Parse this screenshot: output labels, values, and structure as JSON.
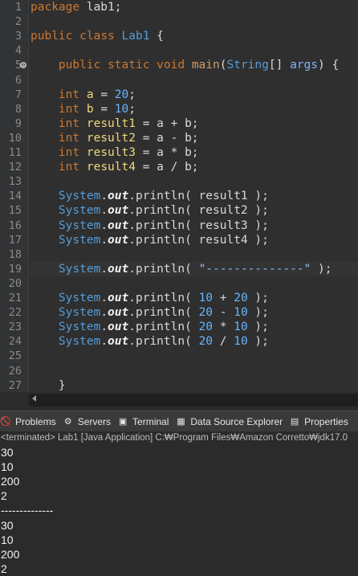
{
  "editor": {
    "line_numbers": [
      "1",
      "2",
      "3",
      "4",
      "5",
      "6",
      "7",
      "8",
      "9",
      "10",
      "11",
      "12",
      "13",
      "14",
      "15",
      "16",
      "17",
      "18",
      "19",
      "20",
      "21",
      "22",
      "23",
      "24",
      "25",
      "26",
      "27"
    ],
    "fold_marker": "⊖",
    "lines": [
      {
        "ln": "1",
        "parts": [
          [
            "kw",
            "package"
          ],
          [
            "pl",
            " lab1;"
          ]
        ]
      },
      {
        "ln": "2",
        "parts": []
      },
      {
        "ln": "3",
        "parts": [
          [
            "kw",
            "public"
          ],
          [
            "pl",
            " "
          ],
          [
            "kw",
            "class"
          ],
          [
            "pl",
            " "
          ],
          [
            "cls",
            "Lab1"
          ],
          [
            "pl",
            " {"
          ]
        ]
      },
      {
        "ln": "4",
        "parts": []
      },
      {
        "ln": "5",
        "parts": [
          [
            "pl",
            "    "
          ],
          [
            "kw",
            "public"
          ],
          [
            "pl",
            " "
          ],
          [
            "kw",
            "static"
          ],
          [
            "pl",
            " "
          ],
          [
            "kw",
            "void"
          ],
          [
            "pl",
            " "
          ],
          [
            "fn",
            "main"
          ],
          [
            "pl",
            "("
          ],
          [
            "cls",
            "String"
          ],
          [
            "pl",
            "[] "
          ],
          [
            "args",
            "args"
          ],
          [
            "pl",
            ") {"
          ]
        ]
      },
      {
        "ln": "6",
        "parts": []
      },
      {
        "ln": "7",
        "parts": [
          [
            "pl",
            "    "
          ],
          [
            "kw",
            "int"
          ],
          [
            "pl",
            " "
          ],
          [
            "var",
            "a"
          ],
          [
            "pl",
            " = "
          ],
          [
            "num",
            "20"
          ],
          [
            "pl",
            ";"
          ]
        ]
      },
      {
        "ln": "8",
        "parts": [
          [
            "pl",
            "    "
          ],
          [
            "kw",
            "int"
          ],
          [
            "pl",
            " "
          ],
          [
            "var",
            "b"
          ],
          [
            "pl",
            " = "
          ],
          [
            "num",
            "10"
          ],
          [
            "pl",
            ";"
          ]
        ]
      },
      {
        "ln": "9",
        "parts": [
          [
            "pl",
            "    "
          ],
          [
            "kw",
            "int"
          ],
          [
            "pl",
            " "
          ],
          [
            "var",
            "result1"
          ],
          [
            "pl",
            " = a + b;"
          ]
        ]
      },
      {
        "ln": "10",
        "parts": [
          [
            "pl",
            "    "
          ],
          [
            "kw",
            "int"
          ],
          [
            "pl",
            " "
          ],
          [
            "var",
            "result2"
          ],
          [
            "pl",
            " = a - b;"
          ]
        ]
      },
      {
        "ln": "11",
        "parts": [
          [
            "pl",
            "    "
          ],
          [
            "kw",
            "int"
          ],
          [
            "pl",
            " "
          ],
          [
            "var",
            "result3"
          ],
          [
            "pl",
            " = a * b;"
          ]
        ]
      },
      {
        "ln": "12",
        "parts": [
          [
            "pl",
            "    "
          ],
          [
            "kw",
            "int"
          ],
          [
            "pl",
            " "
          ],
          [
            "var",
            "result4"
          ],
          [
            "pl",
            " = a / b;"
          ]
        ]
      },
      {
        "ln": "13",
        "parts": []
      },
      {
        "ln": "14",
        "parts": [
          [
            "pl",
            "    "
          ],
          [
            "cls",
            "System"
          ],
          [
            "pl",
            "."
          ],
          [
            "out",
            "out"
          ],
          [
            "pl",
            ".println( result1 );"
          ]
        ]
      },
      {
        "ln": "15",
        "parts": [
          [
            "pl",
            "    "
          ],
          [
            "cls",
            "System"
          ],
          [
            "pl",
            "."
          ],
          [
            "out",
            "out"
          ],
          [
            "pl",
            ".println( result2 );"
          ]
        ]
      },
      {
        "ln": "16",
        "parts": [
          [
            "pl",
            "    "
          ],
          [
            "cls",
            "System"
          ],
          [
            "pl",
            "."
          ],
          [
            "out",
            "out"
          ],
          [
            "pl",
            ".println( result3 );"
          ]
        ]
      },
      {
        "ln": "17",
        "parts": [
          [
            "pl",
            "    "
          ],
          [
            "cls",
            "System"
          ],
          [
            "pl",
            "."
          ],
          [
            "out",
            "out"
          ],
          [
            "pl",
            ".println( result4 );"
          ]
        ]
      },
      {
        "ln": "18",
        "parts": []
      },
      {
        "ln": "19",
        "parts": [
          [
            "pl",
            "    "
          ],
          [
            "cls",
            "System"
          ],
          [
            "pl",
            "."
          ],
          [
            "out",
            "out"
          ],
          [
            "pl",
            ".println( "
          ],
          [
            "str",
            "\"--------------\""
          ],
          [
            "pl",
            " );"
          ]
        ]
      },
      {
        "ln": "20",
        "parts": []
      },
      {
        "ln": "21",
        "parts": [
          [
            "pl",
            "    "
          ],
          [
            "cls",
            "System"
          ],
          [
            "pl",
            "."
          ],
          [
            "out",
            "out"
          ],
          [
            "pl",
            ".println( "
          ],
          [
            "num",
            "10"
          ],
          [
            "pl",
            " + "
          ],
          [
            "num",
            "20"
          ],
          [
            "pl",
            " );"
          ]
        ]
      },
      {
        "ln": "22",
        "parts": [
          [
            "pl",
            "    "
          ],
          [
            "cls",
            "System"
          ],
          [
            "pl",
            "."
          ],
          [
            "out",
            "out"
          ],
          [
            "pl",
            ".println( "
          ],
          [
            "num",
            "20"
          ],
          [
            "pl",
            " - "
          ],
          [
            "num",
            "10"
          ],
          [
            "pl",
            " );"
          ]
        ]
      },
      {
        "ln": "23",
        "parts": [
          [
            "pl",
            "    "
          ],
          [
            "cls",
            "System"
          ],
          [
            "pl",
            "."
          ],
          [
            "out",
            "out"
          ],
          [
            "pl",
            ".println( "
          ],
          [
            "num",
            "20"
          ],
          [
            "pl",
            " * "
          ],
          [
            "num",
            "10"
          ],
          [
            "pl",
            " );"
          ]
        ]
      },
      {
        "ln": "24",
        "parts": [
          [
            "pl",
            "    "
          ],
          [
            "cls",
            "System"
          ],
          [
            "pl",
            "."
          ],
          [
            "out",
            "out"
          ],
          [
            "pl",
            ".println( "
          ],
          [
            "num",
            "20"
          ],
          [
            "pl",
            " / "
          ],
          [
            "num",
            "10"
          ],
          [
            "pl",
            " );"
          ]
        ]
      },
      {
        "ln": "25",
        "parts": []
      },
      {
        "ln": "26",
        "parts": []
      },
      {
        "ln": "27",
        "parts": [
          [
            "pl",
            "    }"
          ]
        ]
      }
    ],
    "current_line": "19"
  },
  "console": {
    "tabs": [
      {
        "label": "Problems",
        "icon": "problems-icon",
        "glyph": "🚫"
      },
      {
        "label": "Servers",
        "icon": "servers-icon",
        "glyph": "⚙"
      },
      {
        "label": "Terminal",
        "icon": "terminal-icon",
        "glyph": "▣"
      },
      {
        "label": "Data Source Explorer",
        "icon": "data-source-icon",
        "glyph": "▦"
      },
      {
        "label": "Properties",
        "icon": "properties-icon",
        "glyph": "▤"
      }
    ],
    "header": "<terminated> Lab1 [Java Application] C:₩Program Files₩Amazon Corretto₩jdk17.0",
    "output": [
      "30",
      "10",
      "200",
      "2",
      "--------------",
      "30",
      "10",
      "200",
      "2"
    ]
  },
  "colors": {
    "editor_bg": "#2f2f2f",
    "keyword": "#cc7832",
    "class": "#569cd6",
    "variable": "#f0d87a",
    "number": "#66b6ff",
    "console_bg": "#2b2b2b"
  }
}
